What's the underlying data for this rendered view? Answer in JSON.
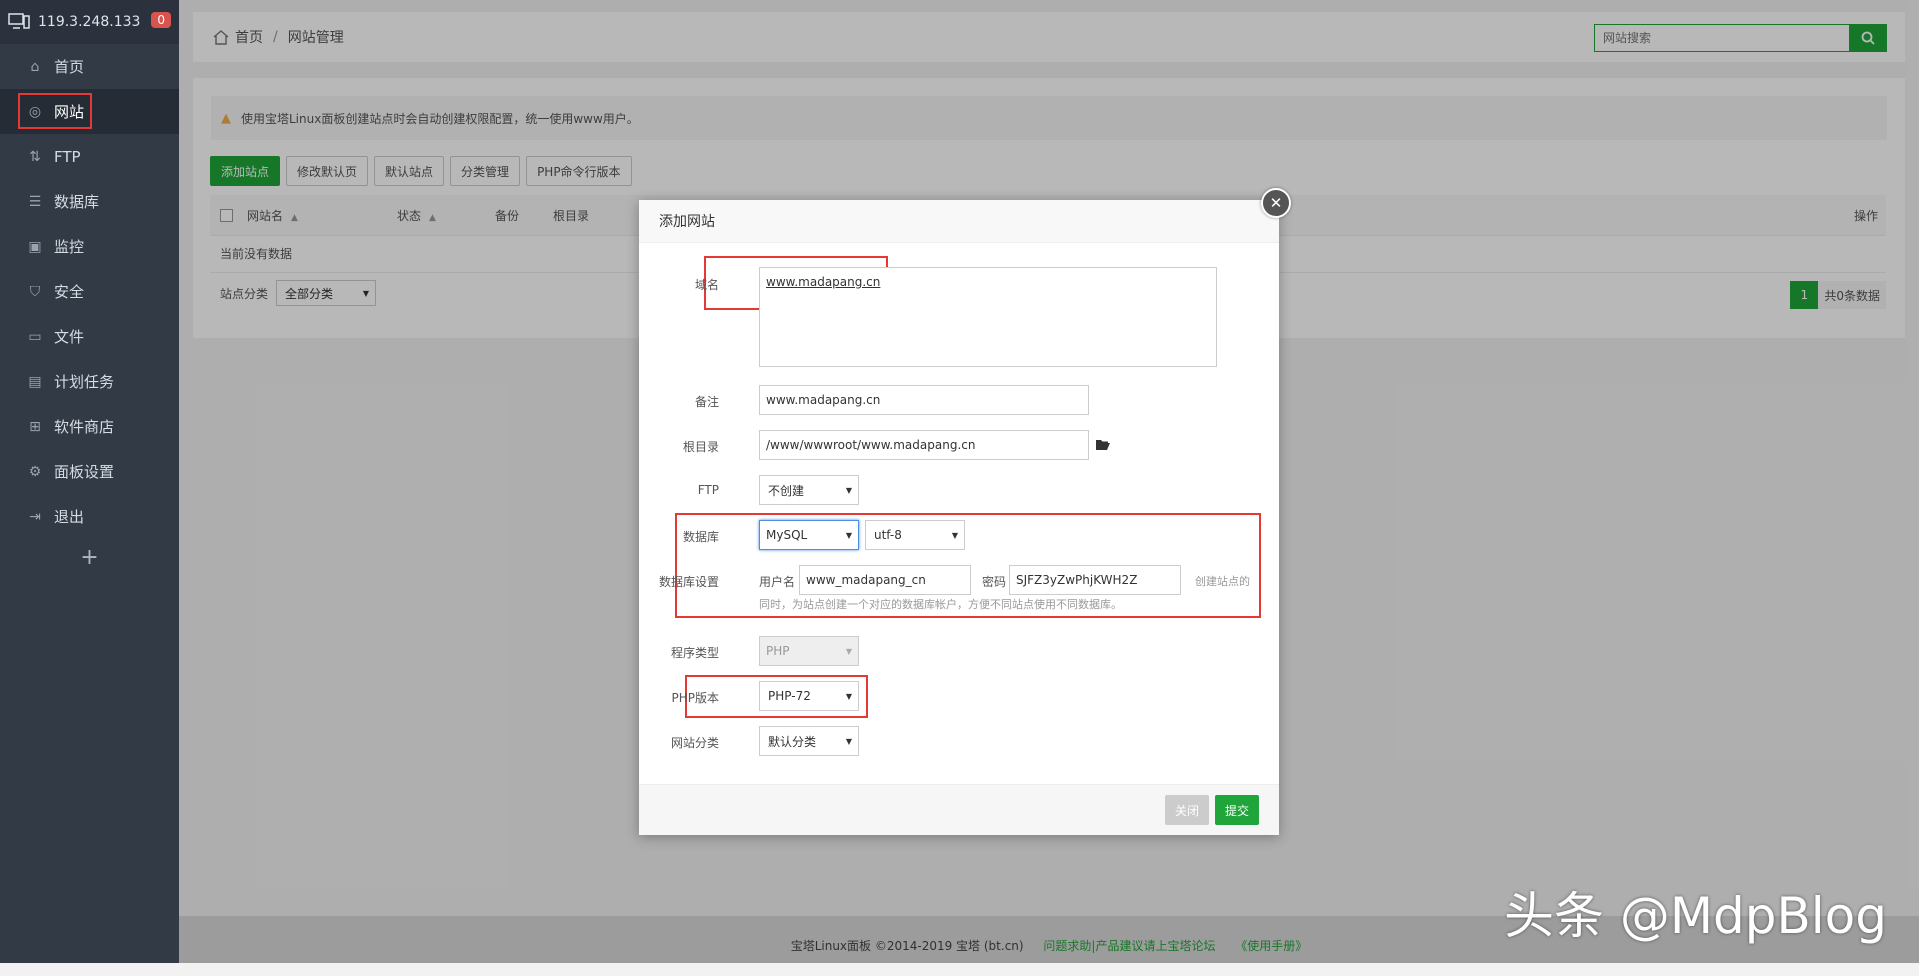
{
  "sidebar": {
    "host": "119.3.248.133",
    "badge": "0",
    "items": [
      {
        "label": "首页",
        "icon": "home-icon"
      },
      {
        "label": "网站",
        "icon": "globe-icon"
      },
      {
        "label": "FTP",
        "icon": "ftp-icon"
      },
      {
        "label": "数据库",
        "icon": "database-icon"
      },
      {
        "label": "监控",
        "icon": "monitor-icon"
      },
      {
        "label": "安全",
        "icon": "shield-icon"
      },
      {
        "label": "文件",
        "icon": "folder-icon"
      },
      {
        "label": "计划任务",
        "icon": "calendar-icon"
      },
      {
        "label": "软件商店",
        "icon": "grid-icon"
      },
      {
        "label": "面板设置",
        "icon": "gear-icon"
      },
      {
        "label": "退出",
        "icon": "logout-icon"
      }
    ],
    "add": "+"
  },
  "header": {
    "breadcrumb_home": "首页",
    "breadcrumb_sep": "/",
    "breadcrumb_current": "网站管理",
    "search_placeholder": "网站搜索"
  },
  "main": {
    "notice": "使用宝塔Linux面板创建站点时会自动创建权限配置，统一使用www用户。",
    "toolbar": [
      "添加站点",
      "修改默认页",
      "默认站点",
      "分类管理",
      "PHP命令行版本"
    ],
    "columns": {
      "name": "网站名",
      "status": "状态",
      "backup": "备份",
      "root": "根目录",
      "action": "操作"
    },
    "empty": "当前没有数据",
    "category_label": "站点分类",
    "category_value": "全部分类",
    "page": "1",
    "total": "共0条数据"
  },
  "modal": {
    "title": "添加网站",
    "domain_label": "域名",
    "domain_value": "www.madapang.cn",
    "remark_label": "备注",
    "remark_value": "www.madapang.cn",
    "root_label": "根目录",
    "root_value": "/www/wwwroot/www.madapang.cn",
    "ftp_label": "FTP",
    "ftp_value": "不创建",
    "db_label": "数据库",
    "db_value": "MySQL",
    "charset_value": "utf-8",
    "dbset_label": "数据库设置",
    "user_label": "用户名",
    "user_value": "www_madapang_cn",
    "pwd_label": "密码",
    "pwd_value": "SJFZ3yZwPhjKWH2Z",
    "db_hint1": "创建站点的",
    "db_hint2": "同时，为站点创建一个对应的数据库帐户，方便不同站点使用不同数据库。",
    "type_label": "程序类型",
    "type_value": "PHP",
    "php_label": "PHP版本",
    "php_value": "PHP-72",
    "cat_label": "网站分类",
    "cat_value": "默认分类",
    "btn_close": "关闭",
    "btn_submit": "提交"
  },
  "footer": {
    "copyright": "宝塔Linux面板 ©2014-2019 宝塔 (bt.cn)",
    "help": "问题求助|产品建议请上宝塔论坛",
    "manual": "《使用手册》"
  },
  "watermark": "头条 @MdpBlog"
}
